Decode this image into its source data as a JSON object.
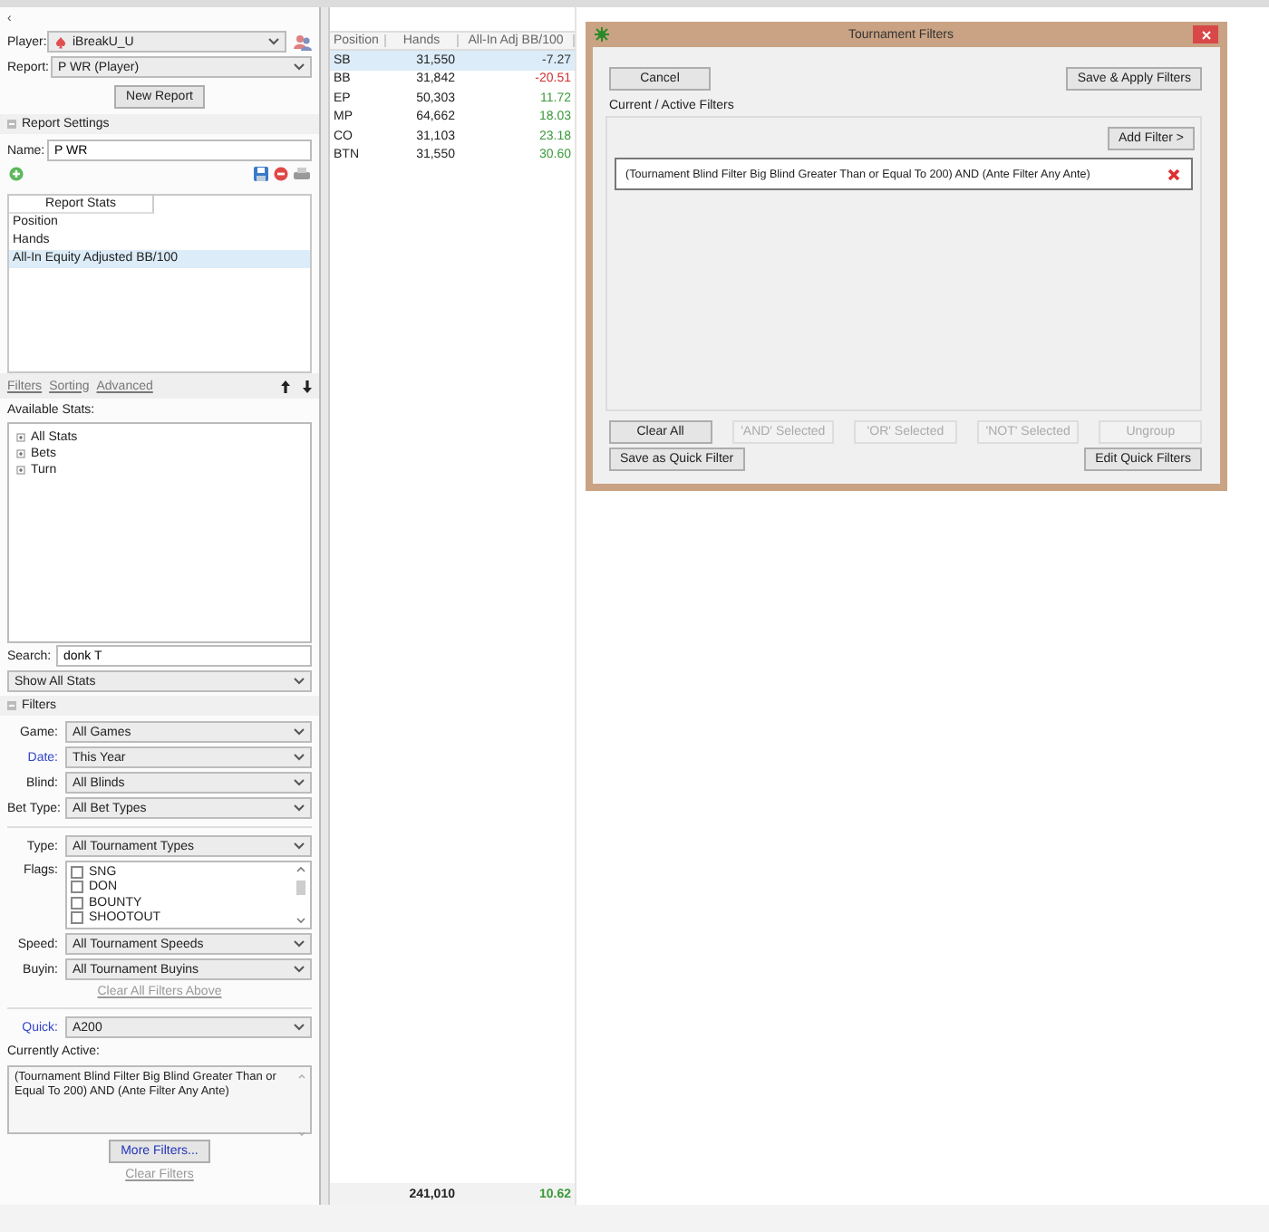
{
  "back_arrow": "‹",
  "player": {
    "label": "Player:",
    "value": "iBreakU_U"
  },
  "report": {
    "label": "Report:",
    "value": "P WR (Player)"
  },
  "new_report_button": "New Report",
  "report_settings": {
    "title": "Report Settings",
    "expanded": true
  },
  "name": {
    "label": "Name:",
    "value": "P WR"
  },
  "report_stats": {
    "header": "Report Stats",
    "items": [
      {
        "label": "Position",
        "selected": false
      },
      {
        "label": "Hands",
        "selected": false
      },
      {
        "label": "All-In Equity Adjusted BB/100",
        "selected": true
      }
    ]
  },
  "links": [
    "Filters",
    "Sorting",
    "Advanced"
  ],
  "available_stats": {
    "label": "Available Stats:",
    "tree": [
      {
        "label": "All Stats",
        "expanded": false
      },
      {
        "label": "Bets",
        "expanded": false
      },
      {
        "label": "Turn",
        "expanded": false
      }
    ]
  },
  "search": {
    "label": "Search:",
    "value": "donk T"
  },
  "show_stats": "Show All Stats",
  "filters": {
    "title": "Filters",
    "expanded": true,
    "selects": [
      {
        "label": "Game:",
        "value": "All Games",
        "link": false
      },
      {
        "label": "Date:",
        "value": "This Year",
        "link": true
      },
      {
        "label": "Blind:",
        "value": "All Blinds",
        "link": false
      },
      {
        "label": "Bet Type:",
        "value": "All Bet Types",
        "link": false
      }
    ],
    "type": {
      "label": "Type:",
      "value": "All Tournament Types",
      "link": false
    },
    "flags": {
      "label": "Flags:",
      "items": [
        {
          "label": "SNG",
          "checked": false
        },
        {
          "label": "DON",
          "checked": false
        },
        {
          "label": "BOUNTY",
          "checked": false
        },
        {
          "label": "SHOOTOUT",
          "checked": false
        }
      ]
    },
    "selects_after": [
      {
        "label": "Speed:",
        "value": "All Tournament Speeds",
        "link": false
      },
      {
        "label": "Buyin:",
        "value": "All Tournament Buyins",
        "link": false
      }
    ],
    "clear_above": "Clear All Filters Above"
  },
  "quick": {
    "label": "Quick:",
    "value": "A200",
    "link": true
  },
  "currently_active": {
    "label": "Currently Active:",
    "text": "(Tournament Blind Filter Big Blind Greater Than or Equal To 200) AND (Ante Filter Any Ante)"
  },
  "more_filters_button": "More Filters...",
  "clear_filters": "Clear Filters",
  "table": {
    "columns": [
      "Position",
      "Hands",
      "All-In Adj BB/100"
    ],
    "rows": [
      {
        "position": "SB",
        "hands": "31,550",
        "value": "-7.27",
        "color": "#333333",
        "selected": true
      },
      {
        "position": "BB",
        "hands": "31,842",
        "value": "-20.51",
        "color": "#d03030",
        "selected": false
      },
      {
        "position": "EP",
        "hands": "50,303",
        "value": "11.72",
        "color": "#3a9a3a",
        "selected": false
      },
      {
        "position": "MP",
        "hands": "64,662",
        "value": "18.03",
        "color": "#3a9a3a",
        "selected": false
      },
      {
        "position": "CO",
        "hands": "31,103",
        "value": "23.18",
        "color": "#3a9a3a",
        "selected": false
      },
      {
        "position": "BTN",
        "hands": "31,550",
        "value": "30.60",
        "color": "#3a9a3a",
        "selected": false
      }
    ],
    "totals": {
      "hands": "241,010",
      "value": "10.62",
      "color": "#3a9a3a"
    }
  },
  "dialog": {
    "title": "Tournament Filters",
    "cancel": "Cancel",
    "save_apply": "Save & Apply Filters",
    "group_label": "Current / Active Filters",
    "add_filter": "Add Filter >",
    "filters": [
      {
        "text": "(Tournament Blind Filter Big Blind Greater Than or Equal To 200) AND (Ante Filter Any Ante)"
      }
    ],
    "buttons": [
      {
        "label": "Clear All",
        "disabled": false
      },
      {
        "label": "'AND' Selected",
        "disabled": true
      },
      {
        "label": "'OR' Selected",
        "disabled": true
      },
      {
        "label": "'NOT' Selected",
        "disabled": true
      },
      {
        "label": "Ungroup",
        "disabled": true
      }
    ],
    "save_quick": "Save as Quick Filter",
    "edit_quick": "Edit Quick Filters"
  }
}
